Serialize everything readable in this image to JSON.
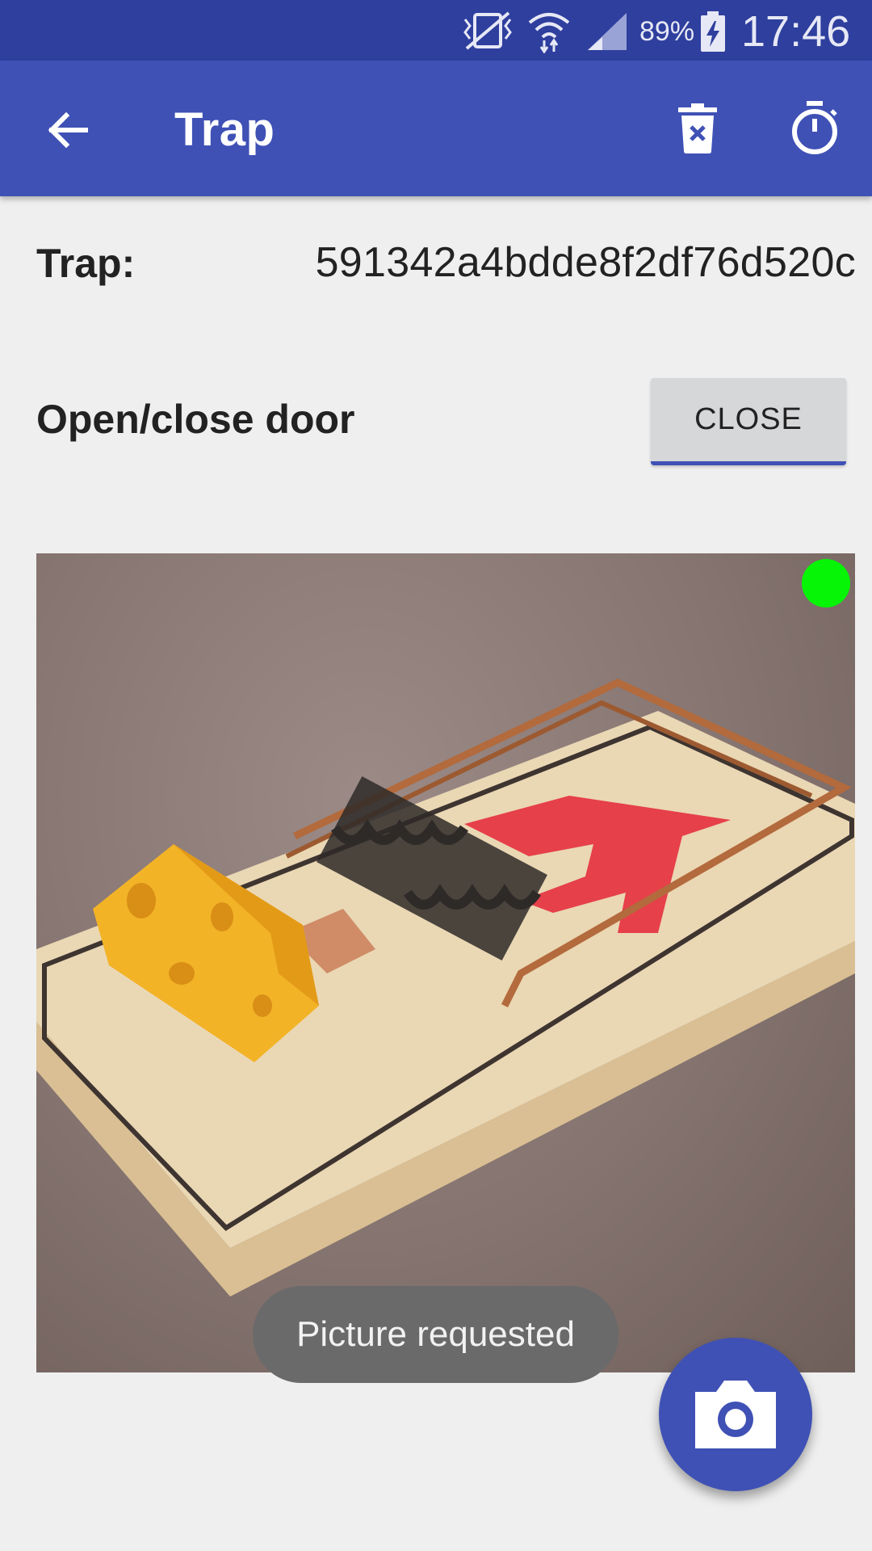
{
  "status_bar": {
    "battery_percent": "89%",
    "time": "17:46",
    "icons": [
      "vibrate-icon",
      "wifi-icon",
      "signal-icon",
      "battery-charging-icon"
    ]
  },
  "app_bar": {
    "title": "Trap",
    "back_icon": "arrow-back-icon",
    "delete_icon": "delete-icon",
    "timer_icon": "timer-icon",
    "background_color": "#3f51b5"
  },
  "content": {
    "trap_label": "Trap:",
    "trap_id": "591342a4bdde8f2df76d520c",
    "door_label": "Open/close door",
    "door_button_label": "CLOSE",
    "photo_subject": "mousetrap-with-cheese",
    "status_indicator_color": "#06f506"
  },
  "toast": {
    "message": "Picture requested"
  },
  "fab": {
    "icon": "camera-icon"
  }
}
